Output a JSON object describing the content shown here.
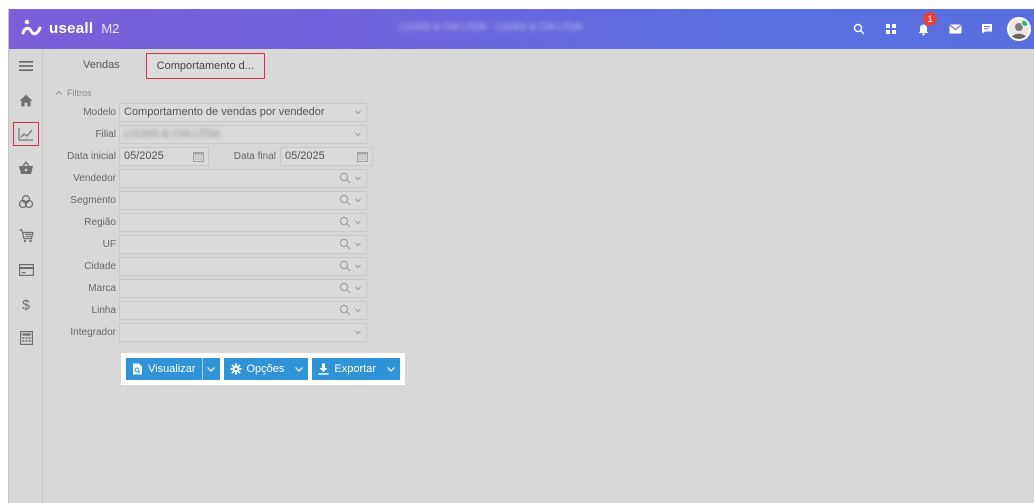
{
  "app": {
    "logo_text": "useall",
    "logo_suffix": "M2",
    "top_center_text": "LOJAS & CIA LTDA - LOJAS & CIA LTDA",
    "notification_count": "1",
    "brand_color": "#6f63dc"
  },
  "tabs": [
    {
      "label": "Vendas"
    },
    {
      "label": "Comportamento d..."
    }
  ],
  "filters": {
    "title": "Filtros",
    "modelo": {
      "label": "Modelo",
      "value": "Comportamento de vendas por vendedor"
    },
    "filial": {
      "label": "Filial",
      "value": "LOJAS & CIA LTDA"
    },
    "data_inicial": {
      "label": "Data inicial",
      "value": "05/2025"
    },
    "data_final": {
      "label": "Data final",
      "value": "05/2025"
    },
    "vendedor": {
      "label": "Vendedor",
      "value": ""
    },
    "segmento": {
      "label": "Segmento",
      "value": ""
    },
    "regiao": {
      "label": "Região",
      "value": ""
    },
    "uf": {
      "label": "UF",
      "value": ""
    },
    "cidade": {
      "label": "Cidade",
      "value": ""
    },
    "marca": {
      "label": "Marca",
      "value": ""
    },
    "linha": {
      "label": "Linha",
      "value": ""
    },
    "integrador": {
      "label": "Integrador",
      "value": ""
    }
  },
  "actions": {
    "visualizar": "Visualizar",
    "opcoes": "Opções",
    "exportar": "Exportar",
    "button_color": "#2f93d6"
  },
  "sidebar": {
    "items": [
      "menu-icon",
      "home-icon",
      "chart-icon",
      "basket-icon",
      "coins-icon",
      "cart-icon",
      "card-icon",
      "dollar-icon",
      "calculator-icon"
    ]
  }
}
